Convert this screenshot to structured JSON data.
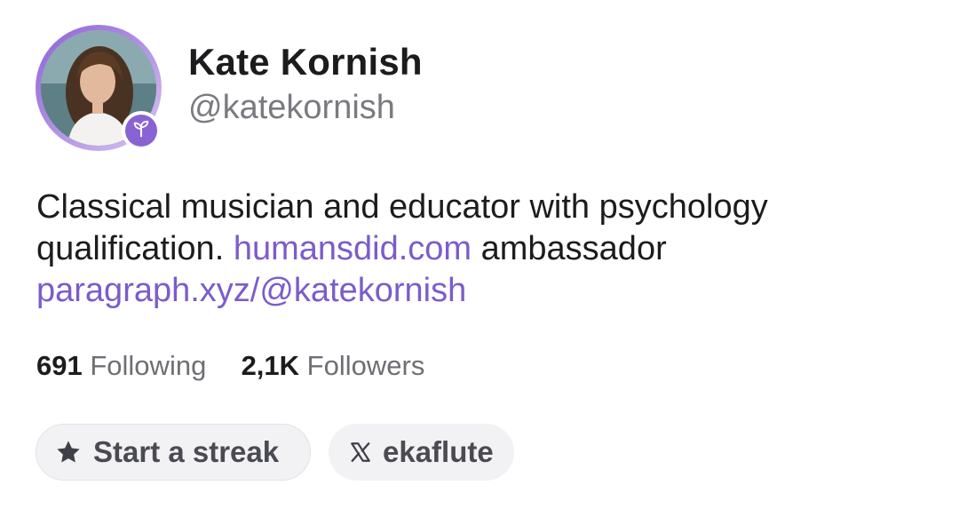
{
  "profile": {
    "display_name": "Kate Kornish",
    "username": "@katekornish",
    "avatar_badge_icon": "sprout-icon"
  },
  "bio": {
    "line1": "Classical musician and educator with psychology",
    "line2_prefix": "qualification. ",
    "link1": "humansdid.com",
    "line2_suffix": " ambassador",
    "link2": "paragraph.xyz/@katekornish"
  },
  "stats": {
    "following_count": "691",
    "following_label": "Following",
    "followers_count": "2,1K",
    "followers_label": "Followers"
  },
  "actions": {
    "streak_label": "Start a streak",
    "streak_icon": "star-icon",
    "x_label": "ekaflute",
    "x_icon": "x-logo-icon"
  },
  "colors": {
    "accent": "#8a63d2",
    "link": "#7b5ccc",
    "muted_text": "#7a7a80",
    "pill_bg": "#f2f2f4"
  }
}
